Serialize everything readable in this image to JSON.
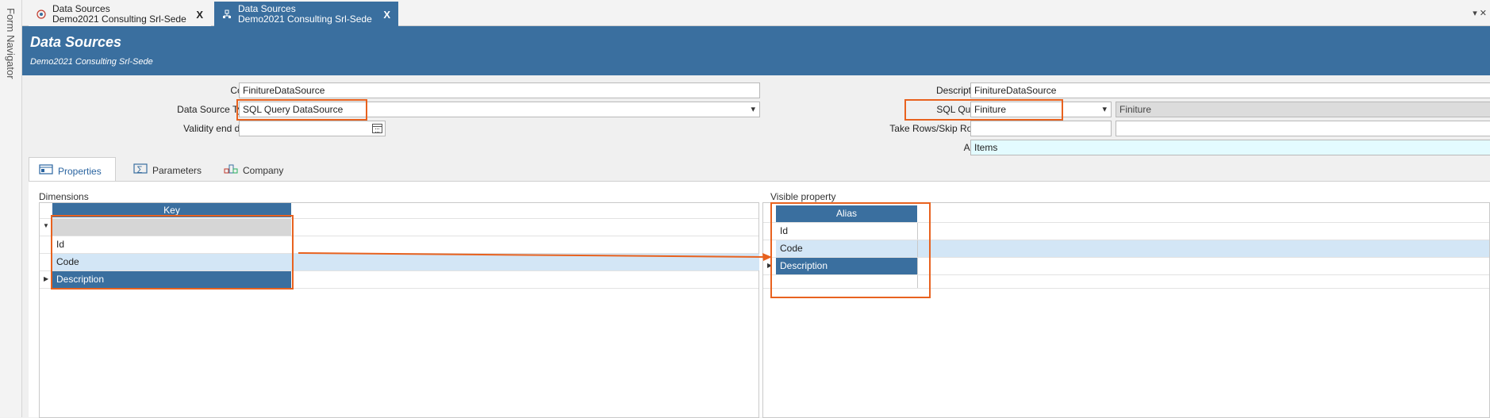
{
  "navigator": {
    "label": "Form Navigator"
  },
  "doc_tabs": [
    {
      "line1": "Data Sources",
      "line2": "Demo2021 Consulting Srl-Sede",
      "close": "X"
    },
    {
      "line1": "Data Sources",
      "line2": "Demo2021 Consulting Srl-Sede",
      "close": "X"
    }
  ],
  "tab_overflow": "▾  ✕",
  "header": {
    "title": "Data Sources",
    "subtitle": "Demo2021 Consulting Srl-Sede"
  },
  "form": {
    "code_label": "Code",
    "code_value": "FinitureDataSource",
    "type_label": "Data Source Type",
    "type_value": "SQL Query DataSource",
    "validity_label": "Validity end date",
    "validity_value": "",
    "desc_label": "Description",
    "desc_value": "FinitureDataSource",
    "sql_label": "SQL Query",
    "sql_value": "Finiture",
    "sql_desc_value": "Finiture",
    "take_label": "Take Rows/Skip Rows",
    "take_value": "",
    "skip_value": "",
    "area_label": "Area",
    "area_value": "Items"
  },
  "subtabs": [
    {
      "label": "Properties"
    },
    {
      "label": "Parameters"
    },
    {
      "label": "Company"
    }
  ],
  "dimensions": {
    "title": "Dimensions",
    "column": "Key",
    "rows": [
      "Id",
      "Code",
      "Description"
    ]
  },
  "visible": {
    "title": "Visible property",
    "column": "Alias",
    "rows": [
      "Id",
      "Code",
      "Description"
    ]
  },
  "colors": {
    "accent": "#3a6f9f",
    "highlight": "#e8621f",
    "row_alt": "#d3e6f6"
  }
}
